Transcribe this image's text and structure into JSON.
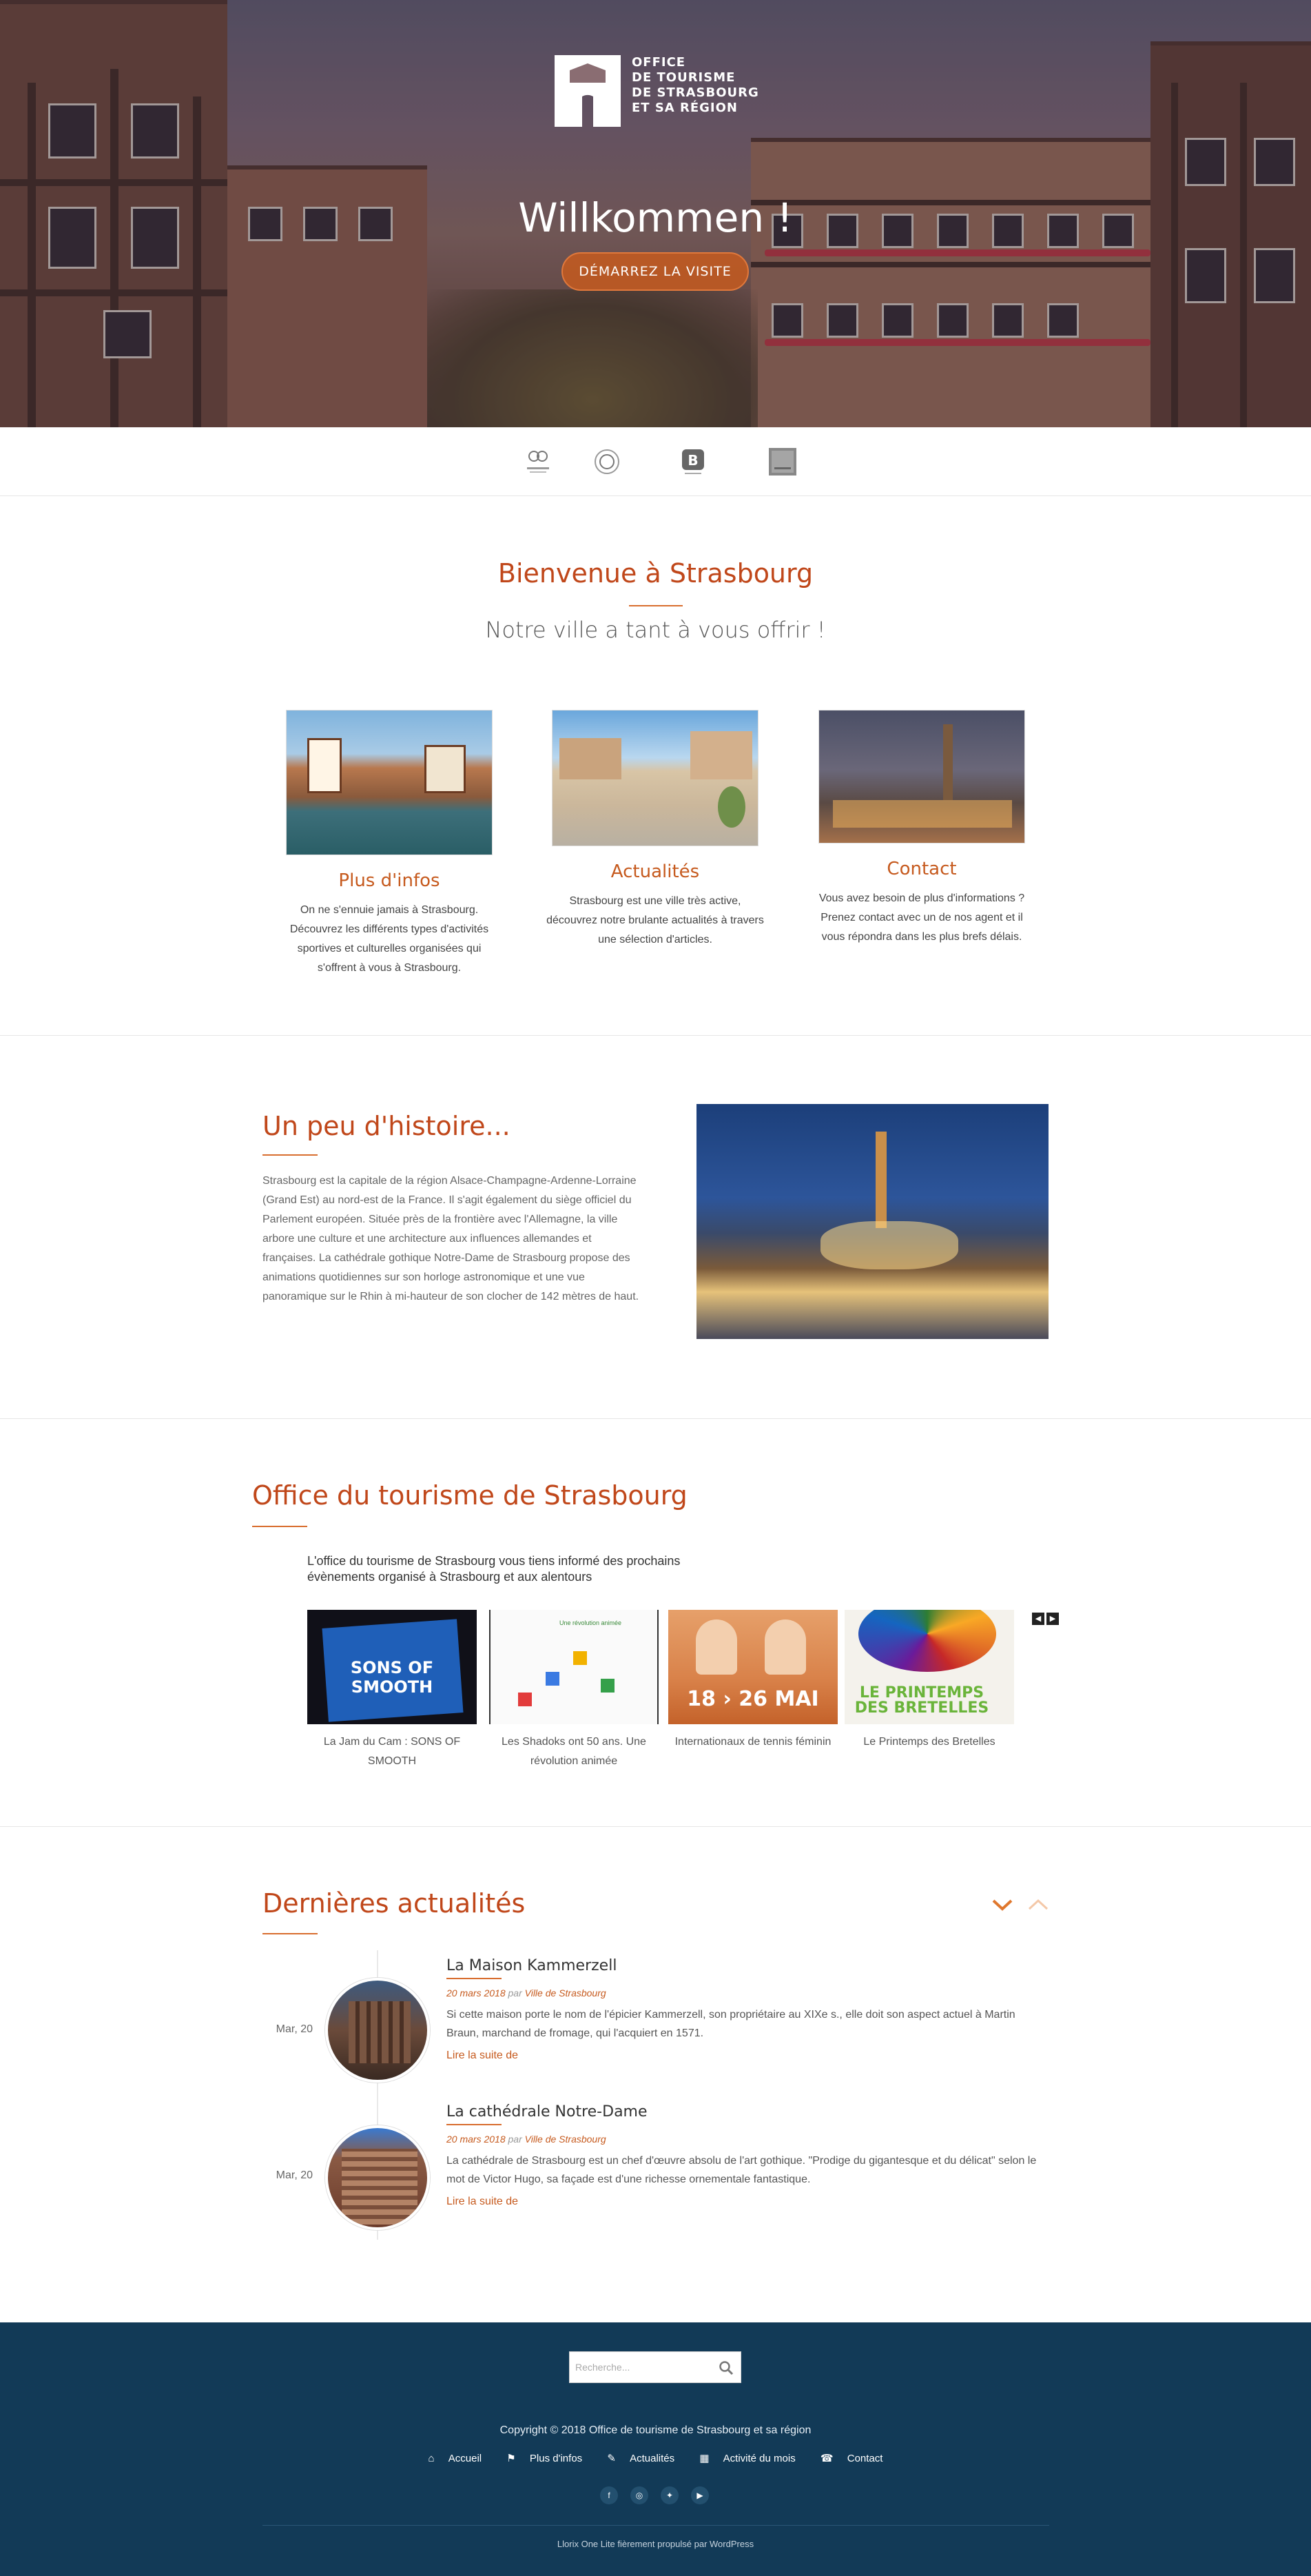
{
  "hero": {
    "logo_lines": [
      "OFFICE",
      "DE TOURISME",
      "DE STRASBOURG",
      "ET SA RÉGION"
    ],
    "title": "Willkommen !",
    "cta": "DÉMARREZ LA VISITE"
  },
  "partners": [
    "alsace-logo",
    "region-logo",
    "booking-logo",
    "partner-logo"
  ],
  "welcome": {
    "title": "Bienvenue à Strasbourg",
    "subtitle": "Notre ville a tant à vous offrir !",
    "cards": [
      {
        "title": "Plus d'infos",
        "text": "On ne s'ennuie jamais à Strasbourg. Découvrez les différents types d'activités sportives et culturelles organisées qui s'offrent à vous à Strasbourg."
      },
      {
        "title": "Actualités",
        "text": "Strasbourg est une ville très active, découvrez notre brulante actualités à travers une sélection d'articles."
      },
      {
        "title": "Contact",
        "text": "Vous avez besoin de plus d'informations ? Prenez contact avec un de nos agent et il vous répondra dans les plus brefs délais."
      }
    ]
  },
  "history": {
    "title": "Un peu d'histoire...",
    "text": "Strasbourg est la capitale de la région Alsace-Champagne-Ardenne-Lorraine (Grand Est) au nord-est de la France. Il s'agit également du siège officiel du Parlement européen. Située près de la frontière avec l'Allemagne, la ville arbore une culture et une architecture aux influences allemandes et françaises. La cathédrale gothique Notre-Dame de Strasbourg propose des animations quotidiennes sur son horloge astronomique et une vue panoramique sur le Rhin à mi-hauteur de son clocher de 142 mètres de haut."
  },
  "office": {
    "title": "Office du tourisme de Strasbourg",
    "description": "L'office du tourisme de Strasbourg vous tiens informé des prochains évènements organisé à Strasbourg et aux alentours",
    "nav_prev": "◀",
    "nav_next": "▶",
    "events": [
      {
        "caption": "La Jam du Cam : SONS OF SMOOTH",
        "image_text": "SONS OF SMOOTH"
      },
      {
        "caption": "Les Shadoks ont 50 ans. Une révolution animée",
        "image_text": "Une révolution animée"
      },
      {
        "caption": "Internationaux de tennis féminin",
        "image_text": "18 › 26 MAI"
      },
      {
        "caption": "Le Printemps des Bretelles",
        "image_text": "LE PRINTEMPS DES BRETELLES"
      }
    ]
  },
  "news": {
    "title": "Dernières actualités",
    "items": [
      {
        "date": "Mar, 20",
        "title": "La Maison Kammerzell",
        "meta_date": "20 mars 2018",
        "meta_by": "par",
        "meta_author": "Ville de Strasbourg",
        "body": "Si cette maison porte le nom de l'épicier Kammerzell, son propriétaire au XIXe s., elle doit son aspect actuel à Martin Braun, marchand de fromage, qui l'acquiert en 1571.",
        "more": "Lire la suite de"
      },
      {
        "date": "Mar, 20",
        "title": "La cathédrale Notre-Dame",
        "meta_date": "20 mars 2018",
        "meta_by": "par",
        "meta_author": "Ville de Strasbourg",
        "body": "La cathédrale de Strasbourg est un chef d'œuvre absolu de l'art gothique. \"Prodige du gigantesque et du délicat\" selon le mot de Victor Hugo, sa façade est d'une richesse ornementale fantastique.",
        "more": "Lire la suite de"
      }
    ]
  },
  "footer": {
    "search_placeholder": "Recherche...",
    "copyright": "Copyright © 2018 Office de tourisme de Strasbourg et sa région",
    "nav": [
      "Accueil",
      "Plus d'infos",
      "Actualités",
      "Activité du mois",
      "Contact"
    ],
    "credit": "Llorix One Lite fièrement propulsé par WordPress"
  },
  "colors": {
    "accent": "#c65a1e",
    "footer_bg": "#123a57"
  }
}
